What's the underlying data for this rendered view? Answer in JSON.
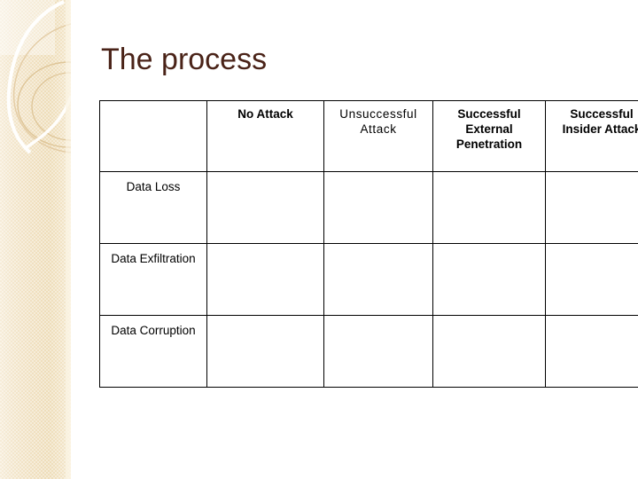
{
  "slide": {
    "title": "The process",
    "title_color": "#4a2318",
    "background_color": "#ffffff"
  },
  "sidebar": {
    "name": "decorative-band",
    "base_color": "#f0e0c0",
    "accent_color": "#e3cda3",
    "highlight_color": "#fdf6e8"
  },
  "matrix": {
    "column_headers": [
      "",
      "No Attack",
      "Unsuccessful Attack",
      "Successful External Penetration",
      "Successful Insider Attack"
    ],
    "row_headers": [
      "Data Loss",
      "Data Exfiltration",
      "Data Corruption"
    ],
    "rows": [
      {
        "label": "Data Loss",
        "cells": [
          "",
          "",
          "",
          ""
        ]
      },
      {
        "label": "Data Exfiltration",
        "cells": [
          "",
          "",
          "",
          ""
        ]
      },
      {
        "label": "Data Corruption",
        "cells": [
          "",
          "",
          "",
          ""
        ]
      }
    ],
    "border_color": "#000000",
    "cell_background": "#ffffff"
  }
}
